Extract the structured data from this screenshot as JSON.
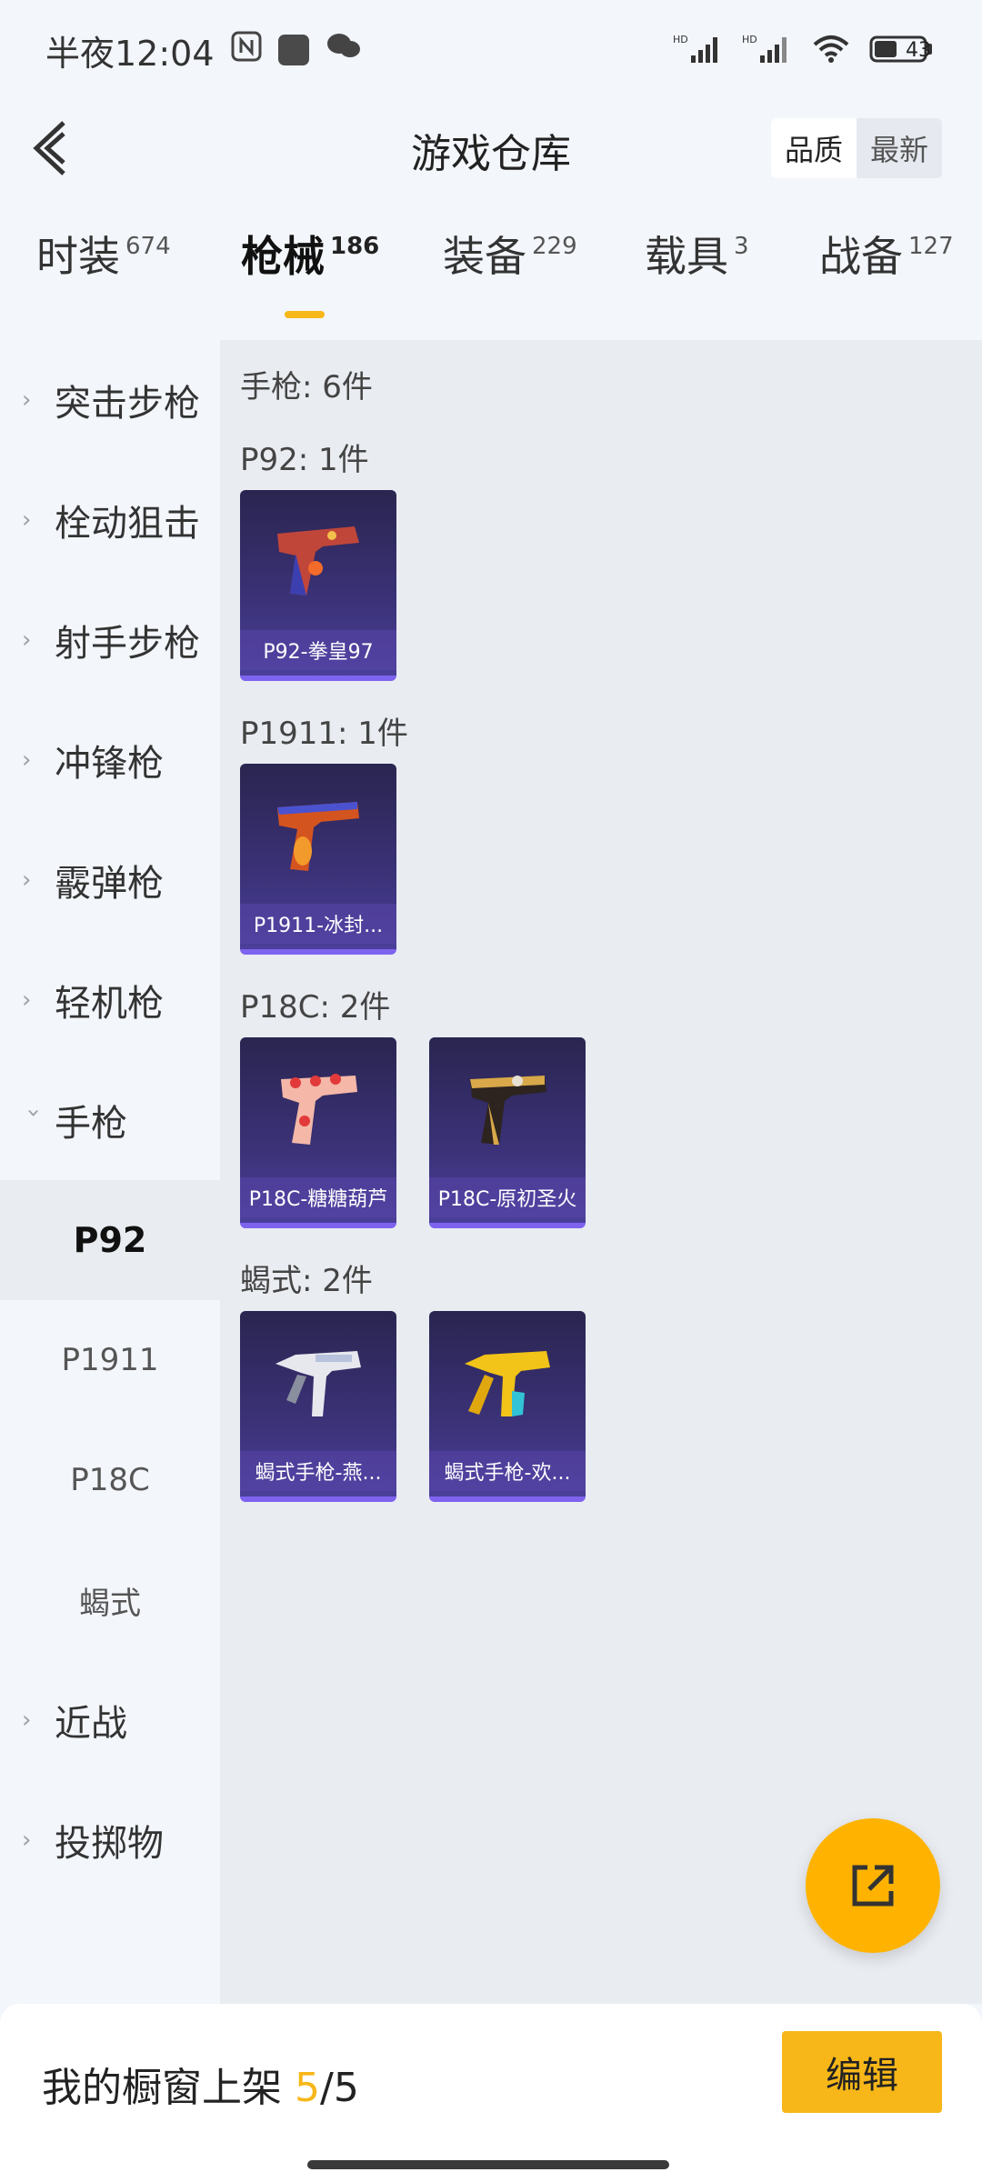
{
  "status_bar": {
    "time": "半夜12:04",
    "battery": "43"
  },
  "header": {
    "title": "游戏仓库",
    "sort_options": [
      "品质",
      "最新"
    ]
  },
  "tabs": [
    {
      "label": "时装",
      "count": "674"
    },
    {
      "label": "枪械",
      "count": "186"
    },
    {
      "label": "装备",
      "count": "229"
    },
    {
      "label": "载具",
      "count": "3"
    },
    {
      "label": "战备",
      "count": "127"
    }
  ],
  "sidebar": {
    "categories": [
      "突击步枪",
      "栓动狙击",
      "射手步枪",
      "冲锋枪",
      "霰弹枪",
      "轻机枪",
      "手枪"
    ],
    "subcategories": [
      "P92",
      "P1911",
      "P18C",
      "蝎式"
    ],
    "after_categories": [
      "近战",
      "投掷物"
    ]
  },
  "content": {
    "summary": "手枪: 6件",
    "groups": [
      {
        "title": "P92: 1件",
        "items": [
          "P92-拳皇97"
        ]
      },
      {
        "title": "P1911: 1件",
        "items": [
          "P1911-冰封..."
        ]
      },
      {
        "title": "P18C: 2件",
        "items": [
          "P18C-糖糖葫芦",
          "P18C-原初圣火"
        ]
      },
      {
        "title": "蝎式: 2件",
        "items": [
          "蝎式手枪-燕...",
          "蝎式手枪-欢..."
        ]
      }
    ]
  },
  "bottom_bar": {
    "label": "我的橱窗上架 ",
    "count_current": "5",
    "count_sep": "/",
    "count_total": "5",
    "edit_button": "编辑"
  },
  "colors": {
    "accent": "#f7b719",
    "card_bg": "#3b3278"
  }
}
